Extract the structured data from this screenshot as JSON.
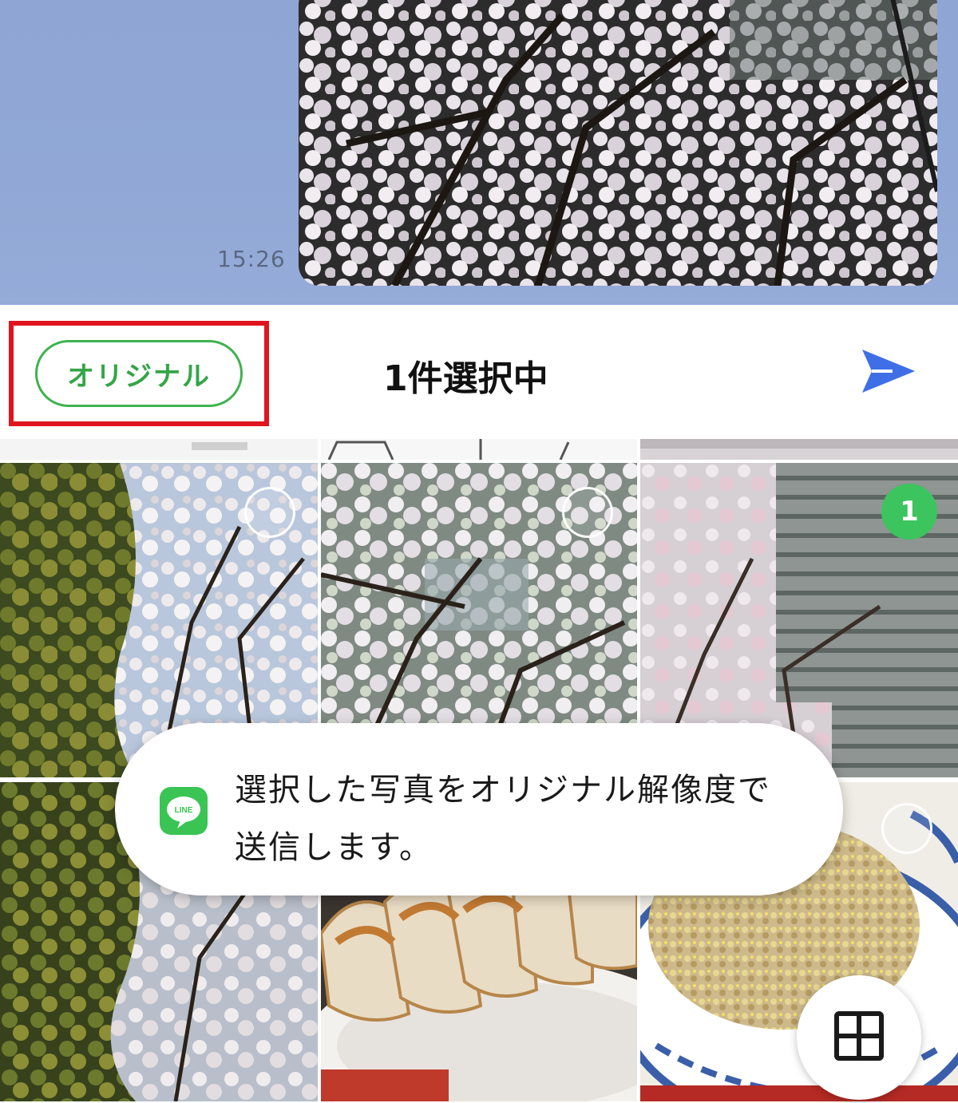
{
  "chat": {
    "message_time": "15:26"
  },
  "toolbar": {
    "original_label": "オリジナル",
    "selection_count": "1件選択中"
  },
  "gallery": {
    "tiles": [
      {
        "selected": false
      },
      {
        "selected": false
      },
      {
        "selected": true,
        "badge": "1"
      },
      {
        "selected": false
      },
      {
        "selected": false
      },
      {
        "selected": false
      }
    ]
  },
  "toast": {
    "message": "選択した写真をオリジナル解像度で送信します。",
    "icon_text": "LINE"
  },
  "colors": {
    "accent_green": "#3cc45e",
    "highlight_red": "#e0141f",
    "send_blue": "#3f6fe6"
  }
}
